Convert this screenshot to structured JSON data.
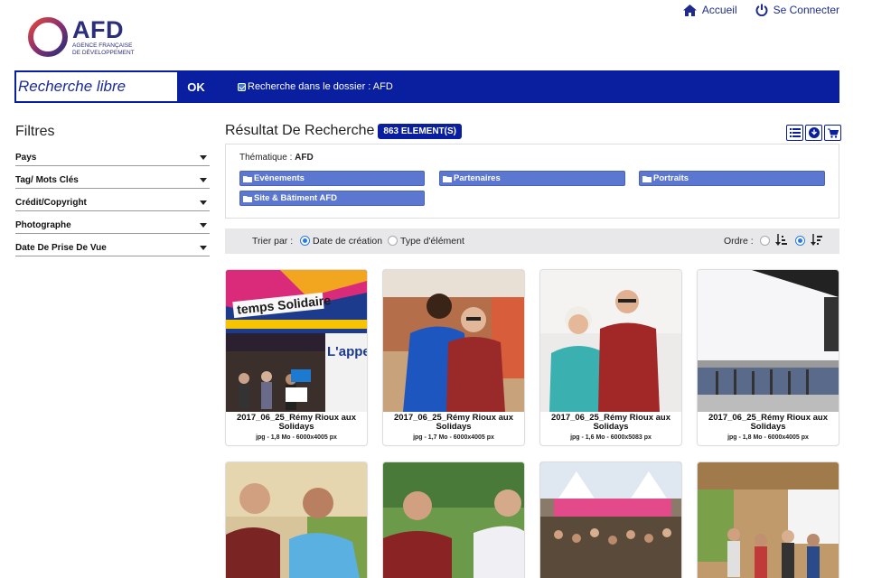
{
  "logo": {
    "name": "AFD",
    "subtitle": "Agence Française de Développement"
  },
  "topnav": {
    "home": "Accueil",
    "login": "Se Connecter"
  },
  "search": {
    "placeholder": "Recherche libre",
    "ok_label": "OK",
    "folder_check_label": "Recherche dans le dossier : AFD",
    "folder_checked": true
  },
  "filters": {
    "title": "Filtres",
    "items": [
      "Pays",
      "Tag/ Mots Clés",
      "Crédit/Copyright",
      "Photographe",
      "Date De Prise De Vue"
    ]
  },
  "results": {
    "title": "Résultat De Recherche",
    "count": "863 ELEMENT(S)",
    "thematic_prefix": "Thématique :",
    "thematic_value": "AFD",
    "folders": [
      "Evènements",
      "Partenaires",
      "Portraits",
      "Site & Bâtiment AFD"
    ]
  },
  "sort": {
    "label": "Trier par :",
    "options": [
      "Date de création",
      "Type d'élément"
    ],
    "selected": "Date de création",
    "order_label": "Ordre :"
  },
  "cards": [
    {
      "title": "2017_06_25_Rémy Rioux aux Solidays",
      "meta": "jpg - 1,8 Mo - 6000x4005 px"
    },
    {
      "title": "2017_06_25_Rémy Rioux aux Solidays",
      "meta": "jpg - 1,7 Mo - 6000x4005 px"
    },
    {
      "title": "2017_06_25_Rémy Rioux aux Solidays",
      "meta": "jpg - 1,6 Mo - 6000x5083 px"
    },
    {
      "title": "2017_06_25_Rémy Rioux aux Solidays",
      "meta": "jpg - 1,8 Mo - 6000x4005 px"
    }
  ],
  "colors": {
    "brand": "#0a1fa0",
    "chip": "#5b77d0",
    "radio": "#2a7be0"
  }
}
